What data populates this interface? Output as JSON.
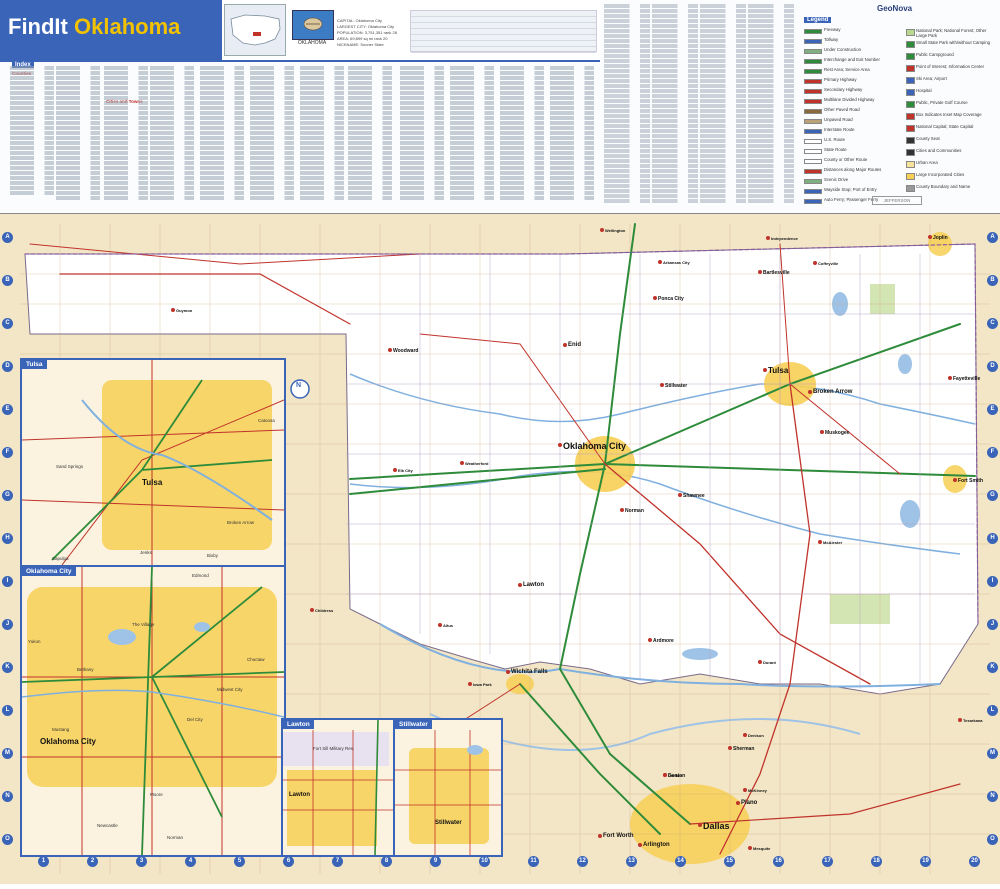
{
  "header": {
    "brand_prefix": "FindIt",
    "state_name": "Oklahoma",
    "publisher": "GeoNova",
    "flag_label": "OKLAHOMA",
    "facts": [
      "CAPITAL: Oklahoma City",
      "LARGEST CITY: Oklahoma City",
      "POPULATION: 3,751,351 rank 28",
      "AREA: 69,899 sq mi rank 20",
      "NICKNAME: Sooner State"
    ]
  },
  "index": {
    "title": "Index",
    "counties_label": "Counties",
    "cities_label": "Cities and Towns"
  },
  "legend": {
    "title": "Legend",
    "left_items": [
      {
        "label": "Freeway",
        "color": "#2e8b3a"
      },
      {
        "label": "Tollway",
        "color": "#3a64b8"
      },
      {
        "label": "Under Construction",
        "color": "#7fb07f"
      },
      {
        "label": "Interchange and Exit Number",
        "color": "#2e8b3a"
      },
      {
        "label": "Rest Area; Service Area",
        "color": "#2e8b3a"
      },
      {
        "label": "Primary Highway",
        "color": "#c0332b"
      },
      {
        "label": "Secondary Highway",
        "color": "#c0332b"
      },
      {
        "label": "Multilane Divided Highway",
        "color": "#c0332b"
      },
      {
        "label": "Other Paved Road",
        "color": "#8a6a3a"
      },
      {
        "label": "Unpaved Road",
        "color": "#b9a27a"
      },
      {
        "label": "Interstate Route",
        "color": "#3a64b8"
      },
      {
        "label": "U.S. Route",
        "color": "#ffffff"
      },
      {
        "label": "State Route",
        "color": "#ffffff"
      },
      {
        "label": "County or Other Route",
        "color": "#ffffff"
      },
      {
        "label": "Distances along Major Routes",
        "color": "#c0332b"
      },
      {
        "label": "Scenic Drive",
        "color": "#7fb07f"
      },
      {
        "label": "Wayside Stop; Port of Entry",
        "color": "#3a64b8"
      },
      {
        "label": "Auto Ferry; Passenger Ferry",
        "color": "#3a64b8"
      }
    ],
    "right_items": [
      {
        "label": "National Park; National Forest; Other Large Park",
        "color": "#b9d88f"
      },
      {
        "label": "Small State Park with/without Camping",
        "color": "#2e8b3a"
      },
      {
        "label": "Public Campground",
        "color": "#2e8b3a"
      },
      {
        "label": "Point of Interest; Information Center",
        "color": "#c0332b"
      },
      {
        "label": "Ski Area; Airport",
        "color": "#3a64b8"
      },
      {
        "label": "Hospital",
        "color": "#3a64b8"
      },
      {
        "label": "Public, Private Golf Course",
        "color": "#2e8b3a"
      },
      {
        "label": "Box Indicates Inset Map Coverage",
        "color": "#c0332b"
      },
      {
        "label": "National Capital; State Capital",
        "color": "#c0332b"
      },
      {
        "label": "County Seat",
        "color": "#333333"
      },
      {
        "label": "Cities and Communities",
        "color": "#333333"
      },
      {
        "label": "Urban Area",
        "color": "#f7e39a"
      },
      {
        "label": "Large Incorporated Cities",
        "color": "#f7cf55"
      },
      {
        "label": "County Boundary and Name",
        "color": "#999999"
      }
    ],
    "county_sample": "JEFFERSON"
  },
  "grid": {
    "rows": [
      "A",
      "B",
      "C",
      "D",
      "E",
      "F",
      "G",
      "H",
      "I",
      "J",
      "K",
      "L",
      "M",
      "N",
      "O"
    ],
    "cols": [
      "1",
      "2",
      "3",
      "4",
      "5",
      "6",
      "7",
      "8",
      "9",
      "10",
      "11",
      "12",
      "13",
      "14",
      "15",
      "16",
      "17",
      "18",
      "19",
      "20"
    ]
  },
  "insets": {
    "tulsa": {
      "title": "Tulsa",
      "city": "Tulsa",
      "towns": [
        "Sand Springs",
        "Broken Arrow",
        "Jenks",
        "Bixby",
        "Sapulpa",
        "Catoosa"
      ]
    },
    "okc": {
      "title": "Oklahoma City",
      "city": "Oklahoma City",
      "towns": [
        "Edmond",
        "Yukon",
        "Moore",
        "Norman",
        "Midwest City",
        "Mustang",
        "Choctaw",
        "Del City",
        "Bethany",
        "The Village",
        "Newcastle"
      ]
    },
    "lawton": {
      "title": "Lawton",
      "city": "Lawton",
      "towns": [
        "Fort Sill Military Res."
      ]
    },
    "stillwater": {
      "title": "Stillwater",
      "city": "Stillwater",
      "towns": []
    }
  },
  "map": {
    "major_cities": [
      {
        "name": "Oklahoma City",
        "size": 9
      },
      {
        "name": "Tulsa",
        "size": 8
      },
      {
        "name": "Broken Arrow",
        "size": 6
      },
      {
        "name": "Wichita Falls",
        "size": 6
      },
      {
        "name": "Dallas",
        "size": 9
      },
      {
        "name": "Fort Worth",
        "size": 6
      },
      {
        "name": "Plano",
        "size": 6
      },
      {
        "name": "Arlington",
        "size": 6
      },
      {
        "name": "Denton",
        "size": 5
      },
      {
        "name": "Norman",
        "size": 5
      },
      {
        "name": "Lawton",
        "size": 6
      },
      {
        "name": "Enid",
        "size": 6
      },
      {
        "name": "Ponca City",
        "size": 5
      },
      {
        "name": "Bartlesville",
        "size": 5
      },
      {
        "name": "Muskogee",
        "size": 5
      },
      {
        "name": "Shawnee",
        "size": 5
      },
      {
        "name": "Fort Smith",
        "size": 5
      },
      {
        "name": "Joplin",
        "size": 5
      },
      {
        "name": "Fayetteville",
        "size": 5
      },
      {
        "name": "Guymon",
        "size": 4
      },
      {
        "name": "Woodward",
        "size": 5
      },
      {
        "name": "Altus",
        "size": 4
      },
      {
        "name": "Ardmore",
        "size": 5
      },
      {
        "name": "Durant",
        "size": 4
      },
      {
        "name": "Sherman",
        "size": 5
      },
      {
        "name": "Denison",
        "size": 4
      },
      {
        "name": "McKinney",
        "size": 4
      },
      {
        "name": "Mesquite",
        "size": 4
      },
      {
        "name": "Weatherford",
        "size": 4
      },
      {
        "name": "Stillwater",
        "size": 5
      },
      {
        "name": "Elk City",
        "size": 4
      },
      {
        "name": "McAlester",
        "size": 4
      },
      {
        "name": "Arkansas City",
        "size": 4
      },
      {
        "name": "Independence",
        "size": 4
      },
      {
        "name": "Coffeyville",
        "size": 4
      },
      {
        "name": "Wellington",
        "size": 4
      },
      {
        "name": "Childress",
        "size": 4
      },
      {
        "name": "Iowa Park",
        "size": 4
      },
      {
        "name": "Denton",
        "size": 4
      },
      {
        "name": "Texarkana",
        "size": 4
      }
    ]
  }
}
